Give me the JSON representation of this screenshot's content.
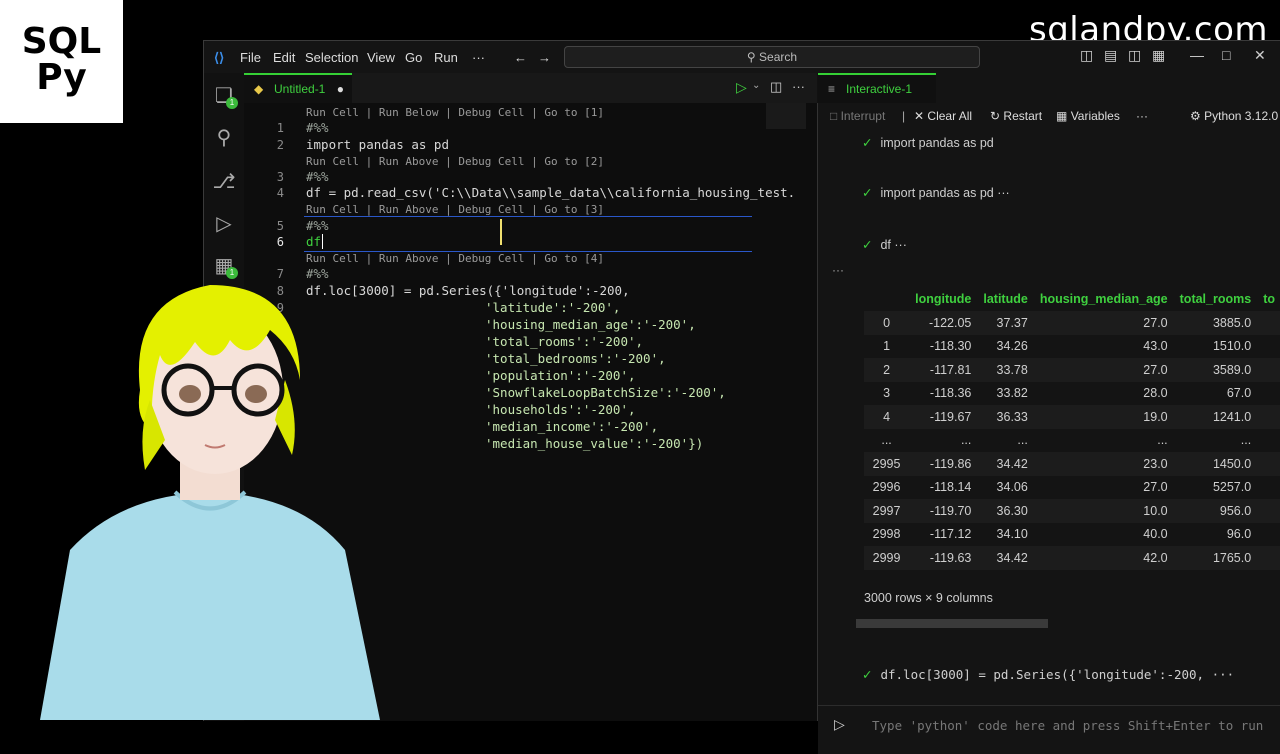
{
  "logo": {
    "line1": "SQL",
    "line2": "Py"
  },
  "brand": "sqlandpy.com",
  "titlebar": {
    "menus": [
      "File",
      "Edit",
      "Selection",
      "View",
      "Go",
      "Run",
      "···"
    ],
    "search": "Search"
  },
  "editor": {
    "tab_label": "Untitled-1",
    "codelens": {
      "l1": "Run Cell | Run Below | Debug Cell | Go to [1]",
      "l2": "Run Cell | Run Above | Debug Cell | Go to [2]",
      "l3": "Run Cell | Run Above | Debug Cell | Go to [3]",
      "l4": "Run Cell | Run Above | Debug Cell | Go to [4]"
    },
    "line_numbers": [
      "1",
      "2",
      "3",
      "4",
      "5",
      "6",
      "7",
      "8",
      "9"
    ],
    "code": {
      "marker": "#%%",
      "import": "import pandas as pd",
      "read_csv": "df = pd.read_csv('C:\\\\Data\\\\sample_data\\\\california_housing_test.",
      "df": "df",
      "loc_line": "df.loc[3000] = pd.Series({'longitude':-200,",
      "cont": [
        "'latitude':'-200',",
        "'housing_median_age':'-200',",
        "'total_rooms':'-200',",
        "'total_bedrooms':'-200',",
        "'population':'-200',",
        "'SnowflakeLoopBatchSize':'-200',",
        "'households':'-200',",
        "'median_income':'-200',",
        "'median_house_value':'-200'})"
      ]
    }
  },
  "interactive": {
    "tab_label": "Interactive-1",
    "toolbar": {
      "interrupt": "Interrupt",
      "clear_all": "Clear All",
      "restart": "Restart",
      "variables": "Variables",
      "more": "···",
      "kernel": "Python 3.12.0"
    },
    "cells": {
      "c0": "import pandas as pd",
      "c1": "import pandas as pd ···",
      "c2": "df ···",
      "c3": "df.loc[3000] = pd.Series({'longitude':-200, ···"
    },
    "table": {
      "columns": [
        "",
        "longitude",
        "latitude",
        "housing_median_age",
        "total_rooms",
        "to"
      ],
      "rows": [
        [
          "0",
          "-122.05",
          "37.37",
          "27.0",
          "3885.0",
          ""
        ],
        [
          "1",
          "-118.30",
          "34.26",
          "43.0",
          "1510.0",
          ""
        ],
        [
          "2",
          "-117.81",
          "33.78",
          "27.0",
          "3589.0",
          ""
        ],
        [
          "3",
          "-118.36",
          "33.82",
          "28.0",
          "67.0",
          ""
        ],
        [
          "4",
          "-119.67",
          "36.33",
          "19.0",
          "1241.0",
          ""
        ],
        [
          "...",
          "...",
          "...",
          "...",
          "...",
          ""
        ],
        [
          "2995",
          "-119.86",
          "34.42",
          "23.0",
          "1450.0",
          ""
        ],
        [
          "2996",
          "-118.14",
          "34.06",
          "27.0",
          "5257.0",
          ""
        ],
        [
          "2997",
          "-119.70",
          "36.30",
          "10.0",
          "956.0",
          ""
        ],
        [
          "2998",
          "-117.12",
          "34.10",
          "40.0",
          "96.0",
          ""
        ],
        [
          "2999",
          "-119.63",
          "34.42",
          "42.0",
          "1765.0",
          ""
        ]
      ],
      "shape": "3000 rows × 9 columns"
    },
    "input_placeholder": "Type 'python' code here and press Shift+Enter to run"
  },
  "colors": {
    "accent": "#3fd03f",
    "badge": "#3cba3c",
    "cell_border": "#2a57c9"
  }
}
